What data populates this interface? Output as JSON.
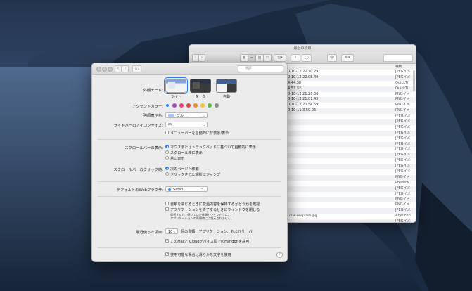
{
  "finder": {
    "title": "最近の項目",
    "dates": [
      "0-10-12 22.10.29",
      "0-10-12 22.08.49",
      "4.44.38",
      "4.53.32",
      "0-10-12 21.26.30",
      "0-10-12 21.01.45",
      "0-10-12 20.54.59",
      "0-10-11 3.59.06",
      "",
      "",
      "",
      "",
      "",
      "",
      "",
      "",
      "",
      "",
      "",
      "",
      "",
      "",
      "",
      "",
      "",
      "",
      "",
      "",
      "",
      "",
      "",
      "",
      "",
      "",
      ""
    ],
    "kinds": [
      "JPEGイメ",
      "JPEGイメ",
      "QuickTi",
      "QuickTi",
      "PNGイメ",
      "PNGイメ",
      "PNGイメ",
      "PNGイメ",
      "JPEGイメ",
      "JPEGイメ",
      "JPEGイメ",
      "JPEGイメ",
      "JPEGイメ",
      "JPEGイメ",
      "JPEGイメ",
      "JPEGイメ",
      "JPEGイメ",
      "JPEGイメ",
      "JPEGイメ",
      "PNGイメ",
      "Preview",
      "JPEGイメ",
      "JPEGイメ",
      "PNGイメ",
      "PNGイメ",
      "JPEGイメ",
      "AFW Fon",
      "JPEGイメ"
    ],
    "kind_header": "種類",
    "footer_file": "n0w-unsplash.jpg"
  },
  "prefs": {
    "search_placeholder": "検索",
    "appearance_label": "外観モード:",
    "themes": [
      "ライト",
      "ダーク",
      "自動"
    ],
    "accent_label": "アクセントカラー:",
    "accent_colors": [
      "#2f7bf5",
      "#a249b7",
      "#e9417e",
      "#e24b3b",
      "#f08a2c",
      "#f3c335",
      "#64ba46",
      "#8e8e8e"
    ],
    "highlight_label": "強調表示色:",
    "highlight_value": "ブルー",
    "sidebar_icon_label": "サイドバーのアイコンサイズ:",
    "sidebar_icon_value": "中",
    "menubar_auto_hide": "メニューバーを自動的に非表示/表示",
    "scrollbar_label": "スクロールバーの表示:",
    "scrollbar_options": [
      "マウスまたはトラックパッドに基づいて自動的に表示",
      "スクロール時に表示",
      "常に表示"
    ],
    "scroll_click_label": "スクロールバーのクリック時:",
    "scroll_click_options": [
      "次のページへ移動",
      "クリックされた場所にジャンプ"
    ],
    "browser_label": "デフォルトのWebブラウザ:",
    "browser_value": "Safari",
    "ask_keep_changes": "書類を閉じるときに変更内容を保持するかどうかを確認",
    "close_windows": "アプリケーションを終了するときにウインドウを閉じる",
    "close_windows_note1": "選択すると、開いていた書類とウインドウは、",
    "close_windows_note2": "アプリケーションの再開時には復元されません。",
    "recent_label": "最近使った項目:",
    "recent_value": "10",
    "recent_suffix": "個の書類、アプリケーション、およびサーバ",
    "handoff": "このMacとiCloudデバイス間でのHandoffを許可",
    "lcd_font": "使用可能な場合は滑らかな文字を使用",
    "help_label": "?"
  }
}
